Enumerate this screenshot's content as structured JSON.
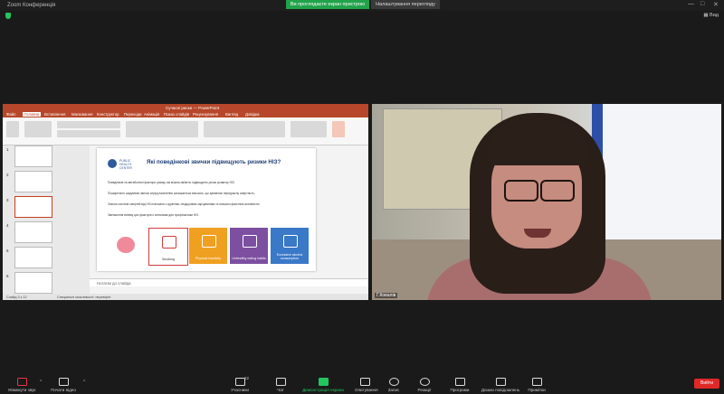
{
  "window": {
    "title": "Zoom Конференція"
  },
  "share_banner": {
    "status": "Ви проглядаєте екран пристрою",
    "settings_label": "Налаштування перегляду"
  },
  "view_label": "Вид",
  "ppt": {
    "filename": "Сучасні риски — PowerPoint",
    "menu": [
      "Файл",
      "Головна",
      "Вставлення",
      "Малювання",
      "Конструктор",
      "Переходи",
      "Анімація",
      "Показ слайдів",
      "Рецензування",
      "Вигляд",
      "Довідка"
    ],
    "slide": {
      "logo_text": "PUBLIC HEALTH CENTER",
      "title": "Які поведінкові звички підвищують ризики НІЗ?",
      "paragraphs": [
        "Поведінкові та метаболічні фактори ризику, які можна змінити, підвищують ризик розвитку НІЗ.",
        "Поширеність шкідливих звичок серед населення залишається високою, що зумовлює передчасну смертність.",
        "Значна частина смертей від НІЗ пов'язана з курінням, нездоровим харчуванням та низькою фізичною активністю.",
        "Зменшення впливу цих факторів є ключовим для профілактики НІЗ."
      ],
      "cards": [
        {
          "label": "",
          "color": "#ffffff"
        },
        {
          "label": "Smoking",
          "color": "#ffffff"
        },
        {
          "label": "Physical inactivity",
          "color": "#f0a020"
        },
        {
          "label": "Unhealthy eating habits",
          "color": "#7c4fa0"
        },
        {
          "label": "Excessive alcohol consumption",
          "color": "#3a78c8"
        }
      ]
    },
    "notes_placeholder": "Нотатки до слайда",
    "status": {
      "slide_count": "Слайд 3 з 12",
      "accessibility": "Спеціальні можливості: перевірте"
    }
  },
  "video": {
    "participant_name": "Г.Ковалів"
  },
  "toolbar": {
    "items": [
      {
        "label": "Увімкнути звук"
      },
      {
        "label": "Почати відео"
      },
      {
        "label": "Учасники",
        "count": "22"
      },
      {
        "label": "Чат"
      },
      {
        "label": "Демонстрація екрана"
      },
      {
        "label": "Опитування"
      },
      {
        "label": "Запис"
      },
      {
        "label": "Реакції"
      },
      {
        "label": "Програми"
      },
      {
        "label": "Дошки повідомлень"
      },
      {
        "label": "Примітки"
      }
    ],
    "leave_label": "Вийти"
  }
}
